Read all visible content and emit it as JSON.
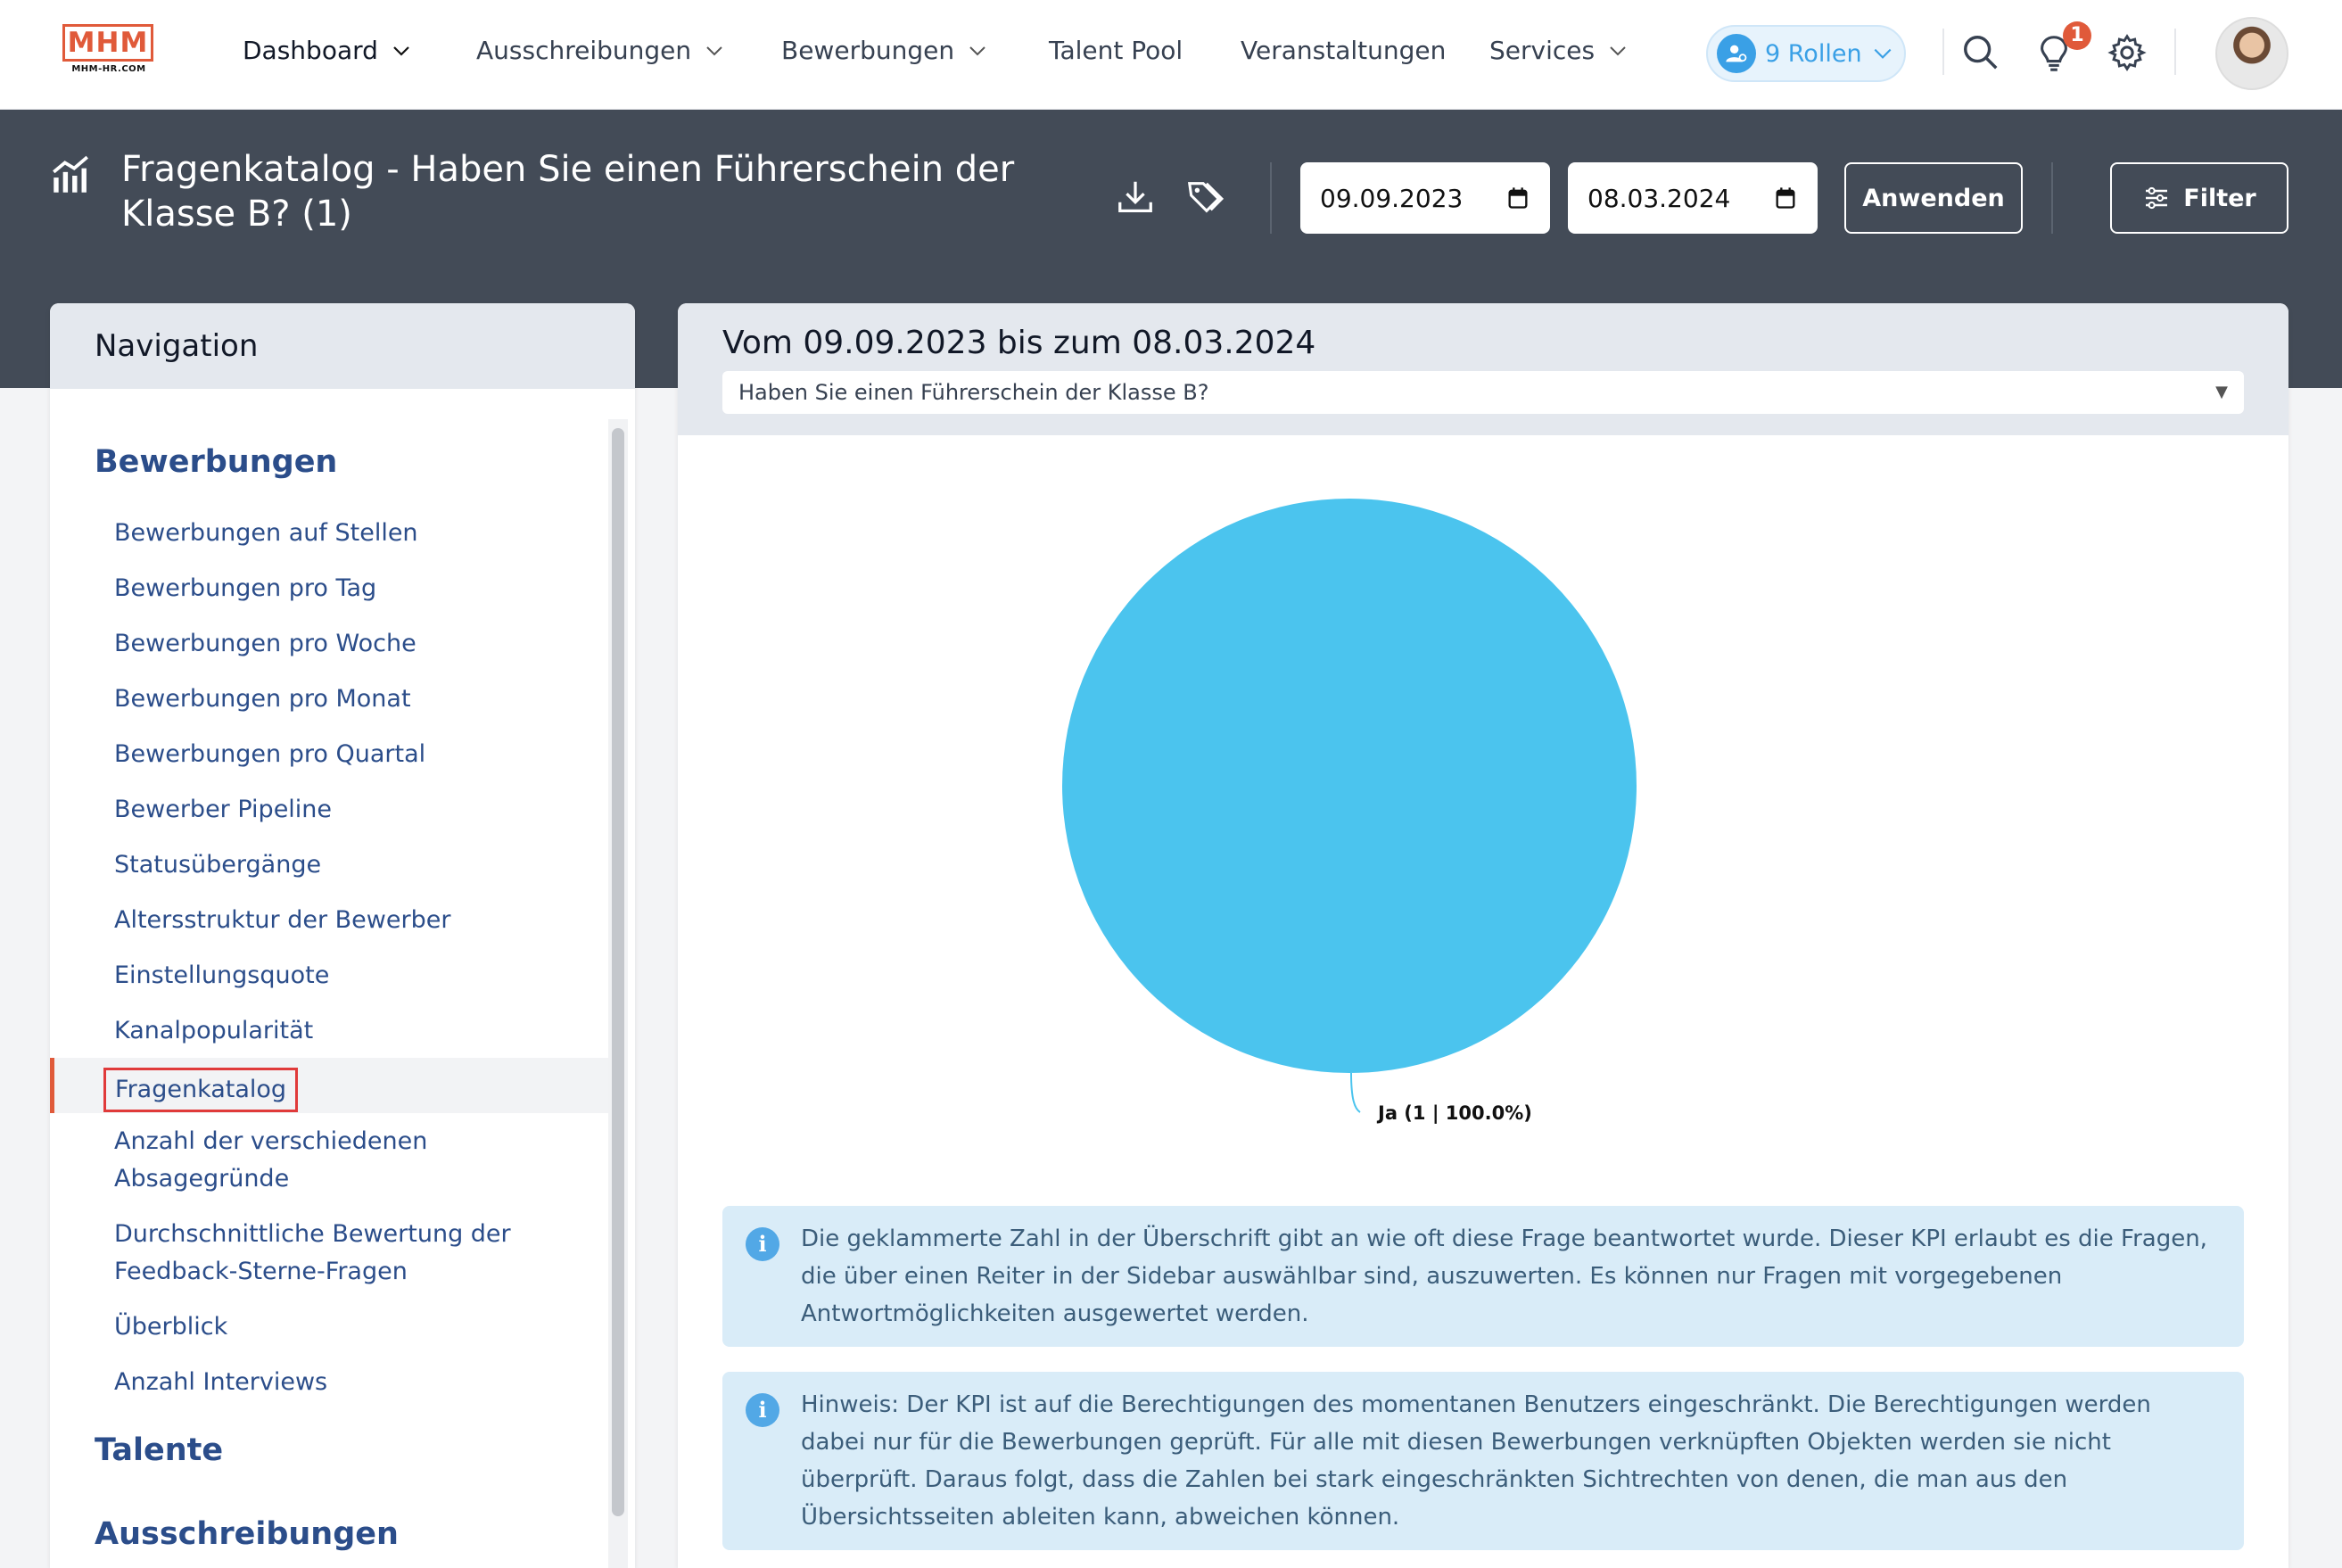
{
  "logo": {
    "text": "MHM",
    "subtext": "MHM-HR.COM"
  },
  "nav": {
    "items": [
      {
        "label": "Dashboard"
      },
      {
        "label": "Ausschreibungen"
      },
      {
        "label": "Bewerbungen"
      },
      {
        "label": "Talent Pool"
      },
      {
        "label": "Veranstaltungen"
      },
      {
        "label": "Services"
      }
    ],
    "roles_label": "9 Rollen",
    "notification_count": "1"
  },
  "header": {
    "title": "Fragenkatalog - Haben Sie einen Führerschein der Klasse B? (1)",
    "date_from": "09.09.2023",
    "date_to": "08.03.2024",
    "apply_label": "Anwenden",
    "filter_label": "Filter"
  },
  "sidebar": {
    "title": "Navigation",
    "sections": [
      {
        "title": "Bewerbungen"
      },
      {
        "title": "Talente"
      },
      {
        "title": "Ausschreibungen"
      }
    ],
    "items": [
      "Bewerbungen auf Stellen",
      "Bewerbungen pro Tag",
      "Bewerbungen pro Woche",
      "Bewerbungen pro Monat",
      "Bewerbungen pro Quartal",
      "Bewerber Pipeline",
      "Statusübergänge",
      "Altersstruktur der Bewerber",
      "Einstellungsquote",
      "Kanalpopularität",
      "Fragenkatalog",
      "Anzahl der verschiedenen Absagegründe",
      "Durchschnittliche Bewertung der Feedback-Sterne-Fragen",
      "Überblick",
      "Anzahl Interviews"
    ],
    "active_item": "Fragenkatalog"
  },
  "main": {
    "range_title": "Vom 09.09.2023 bis zum 08.03.2024",
    "question_select": "Haben Sie einen Führerschein der Klasse B?",
    "info1": "Die geklammerte Zahl in der Überschrift gibt an wie oft diese Frage beantwortet wurde. Dieser KPI erlaubt es die Fragen, die über einen Reiter in der Sidebar auswählbar sind, auszuwerten. Es können nur Fragen mit vorgegebenen Antwortmöglichkeiten ausgewertet werden.",
    "info2": "Hinweis: Der KPI ist auf die Berechtigungen des momentanen Benutzers eingeschränkt. Die Berechtigungen werden dabei nur für die Bewerbungen geprüft. Für alle mit diesen Bewerbungen verknüpften Objekten werden sie nicht überprüft. Daraus folgt, dass die Zahlen bei stark eingeschränkten Sichtrechten von denen, die man aus den Übersichtsseiten ableiten kann, abweichen können.",
    "info_icon": "i"
  },
  "chart_data": {
    "type": "pie",
    "slices": [
      {
        "label": "Ja (1 | 100.0%)",
        "value": 1,
        "percent": 100.0,
        "color": "#4bc4ee"
      }
    ]
  },
  "colors": {
    "accent": "#e05a3a",
    "link": "#2b4d8a",
    "header_bg": "#434b57",
    "pie": "#4bc4ee"
  }
}
